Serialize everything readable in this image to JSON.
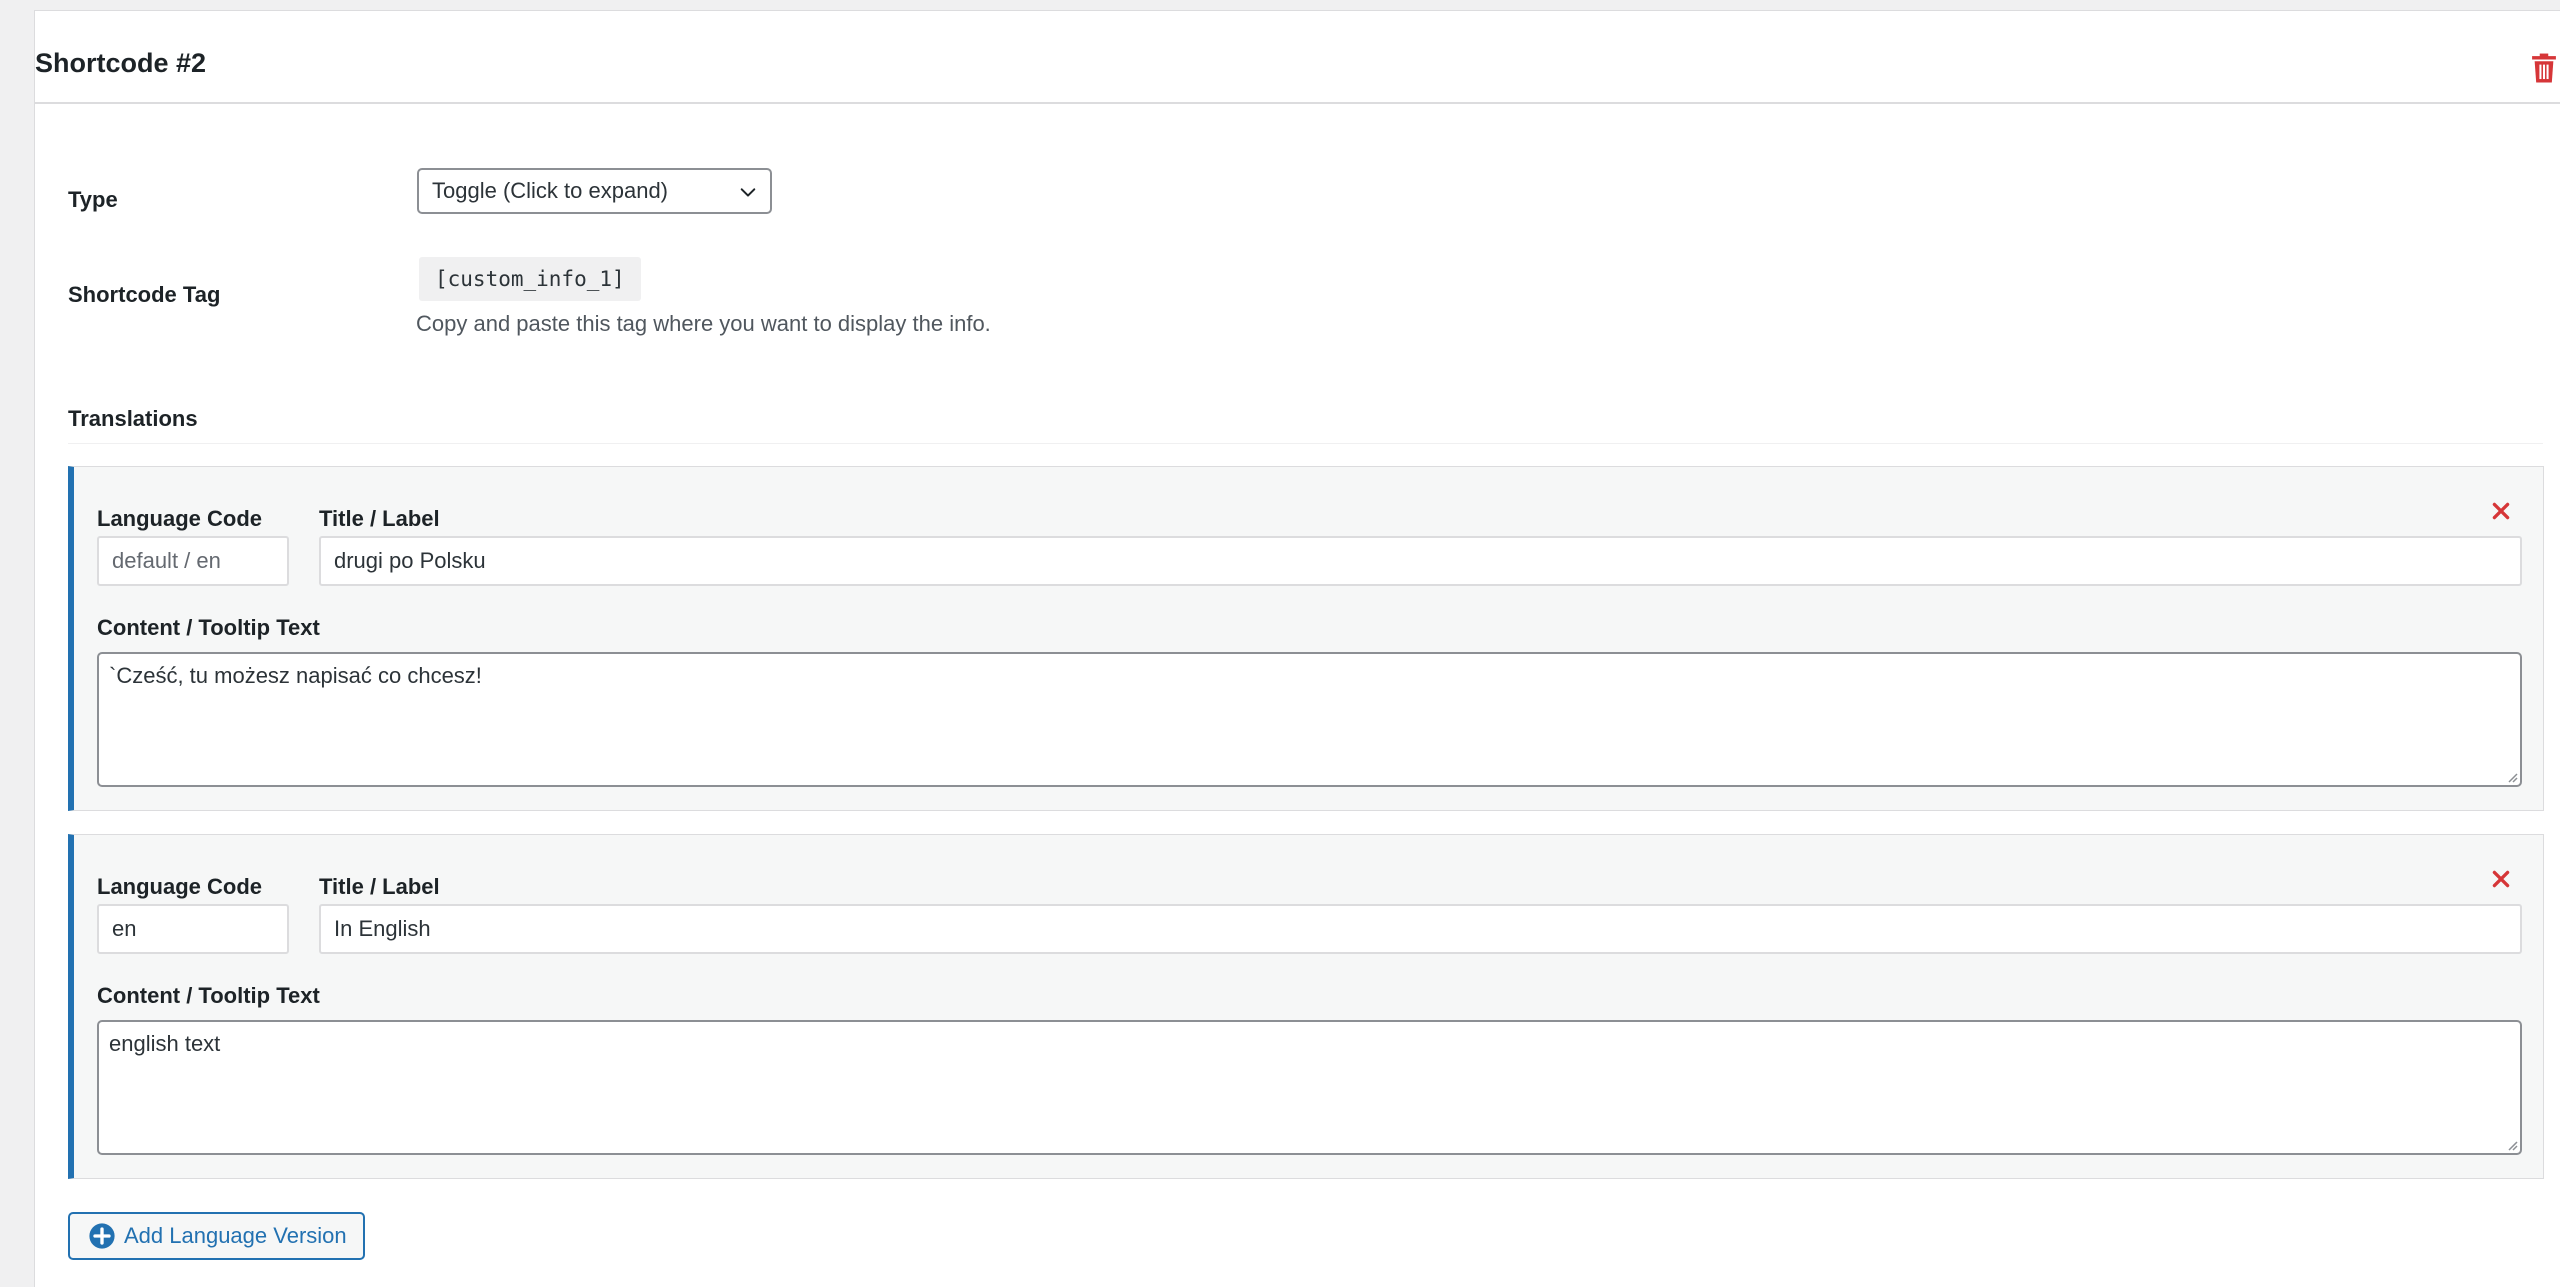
{
  "header": {
    "title": "Shortcode #2",
    "delete_icon": "trash-icon",
    "delete_color": "#d63638"
  },
  "type_row": {
    "label": "Type",
    "selected": "Toggle (Click to expand)"
  },
  "tag_row": {
    "label": "Shortcode Tag",
    "tag": "[custom_info_1]",
    "hint": "Copy and paste this tag where you want to display the info."
  },
  "translations": {
    "label": "Translations",
    "accent_color": "#2271b1",
    "items": [
      {
        "lang_label": "Language Code",
        "lang_value": "default / en",
        "title_label": "Title / Label",
        "title_value": "drugi po Polsku",
        "content_label": "Content / Tooltip Text",
        "content_value": "`Cześć, tu możesz napisać co chcesz!"
      },
      {
        "lang_label": "Language Code",
        "lang_value": "en",
        "title_label": "Title / Label",
        "title_value": "In English",
        "content_label": "Content / Tooltip Text",
        "content_value": "english text"
      }
    ]
  },
  "add_button": {
    "label": "Add Language Version",
    "icon": "plus-circle-icon"
  }
}
